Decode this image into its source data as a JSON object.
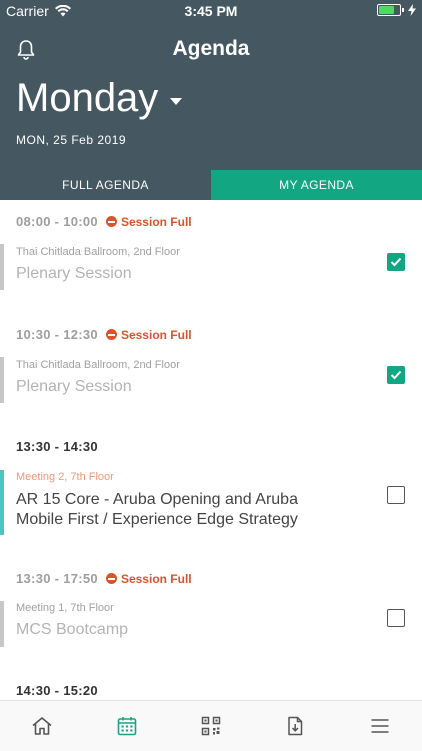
{
  "status_bar": {
    "carrier": "Carrier",
    "time": "3:45 PM",
    "battery_level": 0.85
  },
  "header": {
    "title": "Agenda",
    "day": "Monday",
    "date": "MON, 25 Feb 2019"
  },
  "tabs": [
    {
      "label": "FULL AGENDA",
      "active": false
    },
    {
      "label": "MY AGENDA",
      "active": true
    }
  ],
  "slots": [
    {
      "time": "08:00 - 10:00",
      "status": "Session Full",
      "location": "Thai Chitlada Ballroom, 2nd Floor",
      "name": "Plenary Session",
      "checked": true
    },
    {
      "time": "10:30 - 12:30",
      "status": "Session Full",
      "location": "Thai Chitlada Ballroom, 2nd Floor",
      "name": "Plenary Session",
      "checked": true
    },
    {
      "time": "13:30 - 14:30",
      "status": "",
      "location": "Meeting 2, 7th Floor",
      "name": "AR 15 Core - Aruba Opening and Aruba Mobile First / Experience Edge Strategy",
      "checked": false
    },
    {
      "time": "13:30 - 17:50",
      "status": "Session Full",
      "location": "Meeting 1, 7th Floor",
      "name": "MCS Bootcamp",
      "checked": false
    },
    {
      "time": "14:30 - 15:20"
    }
  ],
  "nav": {
    "items": [
      {
        "icon": "home-icon",
        "active": false
      },
      {
        "icon": "calendar-icon",
        "active": true
      },
      {
        "icon": "qr-code-icon",
        "active": false
      },
      {
        "icon": "download-document-icon",
        "active": false
      },
      {
        "icon": "menu-icon",
        "active": false
      }
    ]
  },
  "colors": {
    "header": "#455760",
    "accent": "#13a682",
    "full": "#d9542b",
    "teal_bar": "#4ec3c1"
  }
}
